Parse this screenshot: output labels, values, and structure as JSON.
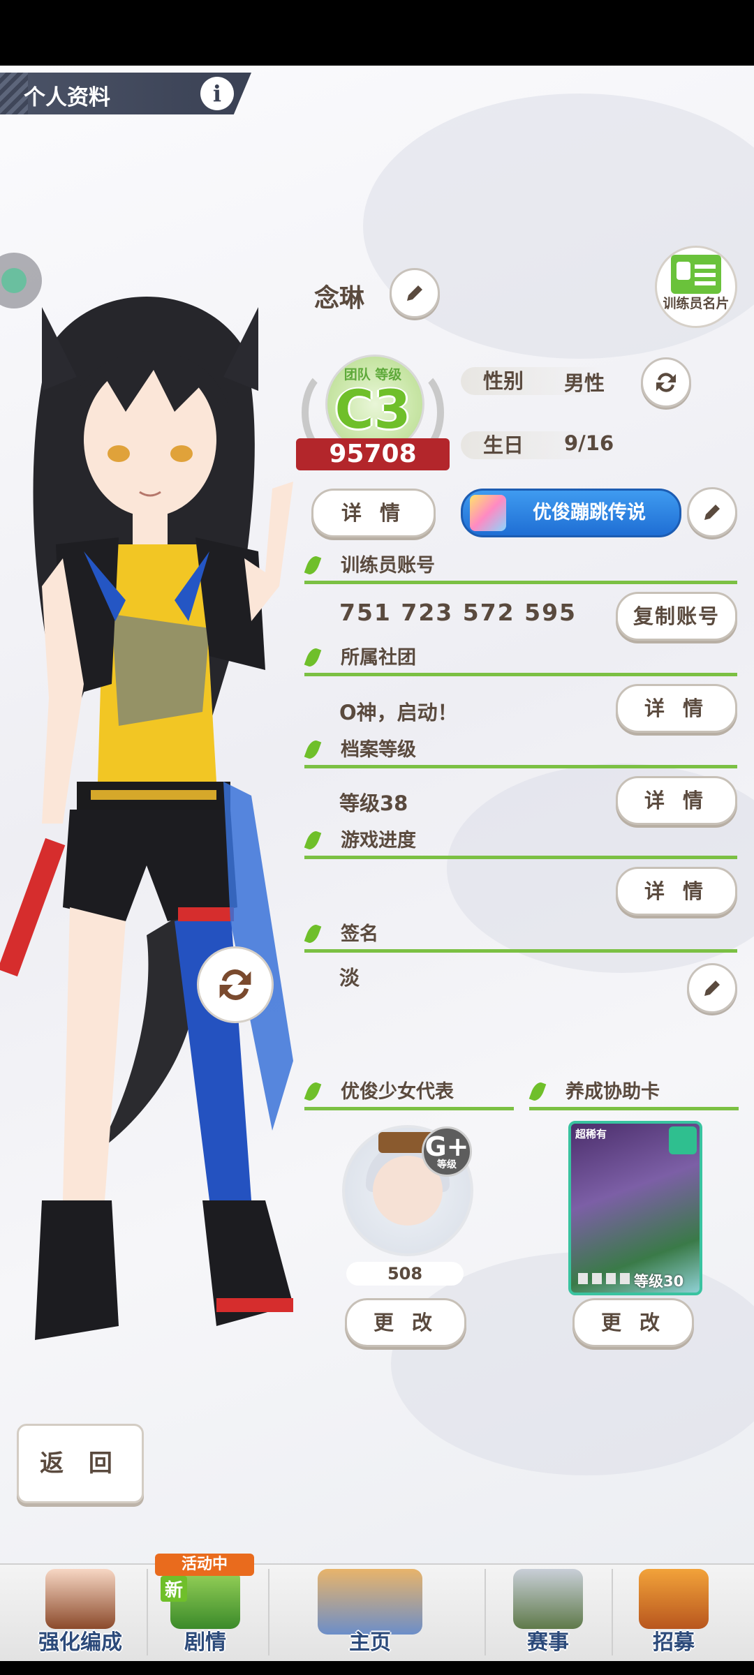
{
  "header": {
    "title": "个人资料",
    "info_icon": "i"
  },
  "profile": {
    "name": "念琳",
    "trainer_card_label": "训练员名片",
    "rank": {
      "team_label": "团队 等级",
      "grade": "C3",
      "score": "95708"
    },
    "gender_key": "性别",
    "gender_value": "男性",
    "birthday_key": "生日",
    "birthday_value": "9/16",
    "details_label": "详 情",
    "title_label": "优俊蹦跳传说"
  },
  "sections": {
    "account": {
      "title": "训练员账号",
      "value": "751 723 572 595",
      "button": "复制账号"
    },
    "club": {
      "title": "所属社团",
      "value": "O神，启动！",
      "button": "详 情"
    },
    "profile_level": {
      "title": "档案等级",
      "value": "等级38",
      "button": "详 情"
    },
    "progress": {
      "title": "游戏进度",
      "button": "详 情"
    },
    "signature": {
      "title": "签名",
      "value": "淡"
    }
  },
  "representative": {
    "title": "优俊少女代表",
    "grade": "G+",
    "grade_label": "等级",
    "rating": "508",
    "change": "更 改"
  },
  "support_card": {
    "title": "养成协助卡",
    "rarity": "超稀有",
    "level": "等级30",
    "change": "更 改"
  },
  "back_button": "返 回",
  "nav": {
    "items": [
      {
        "label": "强化编成"
      },
      {
        "label": "剧情"
      },
      {
        "label": "主页"
      },
      {
        "label": "赛事"
      },
      {
        "label": "招募"
      }
    ],
    "event_tag": "活动中",
    "new_tag": "新"
  },
  "colors": {
    "accent_green": "#7bc043",
    "rank_red": "#b3262b",
    "title_blue": "#1f6ed4",
    "nav_text": "#2c4a7a"
  }
}
